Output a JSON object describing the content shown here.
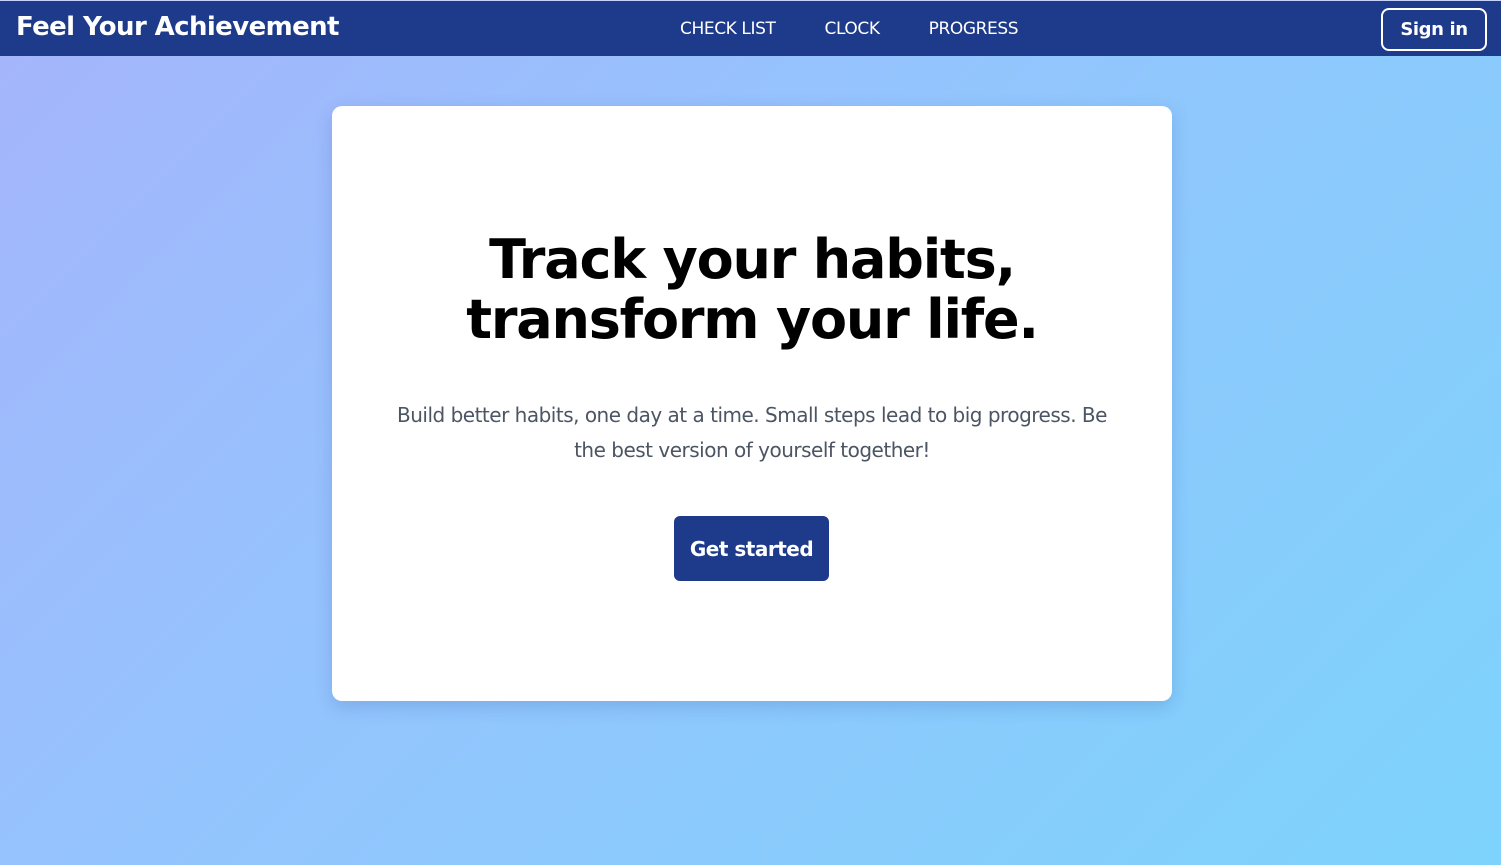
{
  "navbar": {
    "brand": "Feel Your Achievement",
    "links": [
      {
        "label": "CHECK LIST"
      },
      {
        "label": "CLOCK"
      },
      {
        "label": "PROGRESS"
      }
    ],
    "signin_label": "Sign in"
  },
  "hero": {
    "headline_line1": "Track your habits,",
    "headline_line2": "transform your life.",
    "subtext_line1": "Build better habits, one day at a time. Small steps lead to big progress. Be",
    "subtext_line2": "the best version of yourself together!",
    "cta_label": "Get started"
  },
  "colors": {
    "navbar_bg": "#1e3a8a",
    "cta_bg": "#1e3a8a",
    "background_start": "#a5b4fc",
    "background_end": "#7dd3fc",
    "card_bg": "#ffffff",
    "subtext": "#4b5563"
  }
}
